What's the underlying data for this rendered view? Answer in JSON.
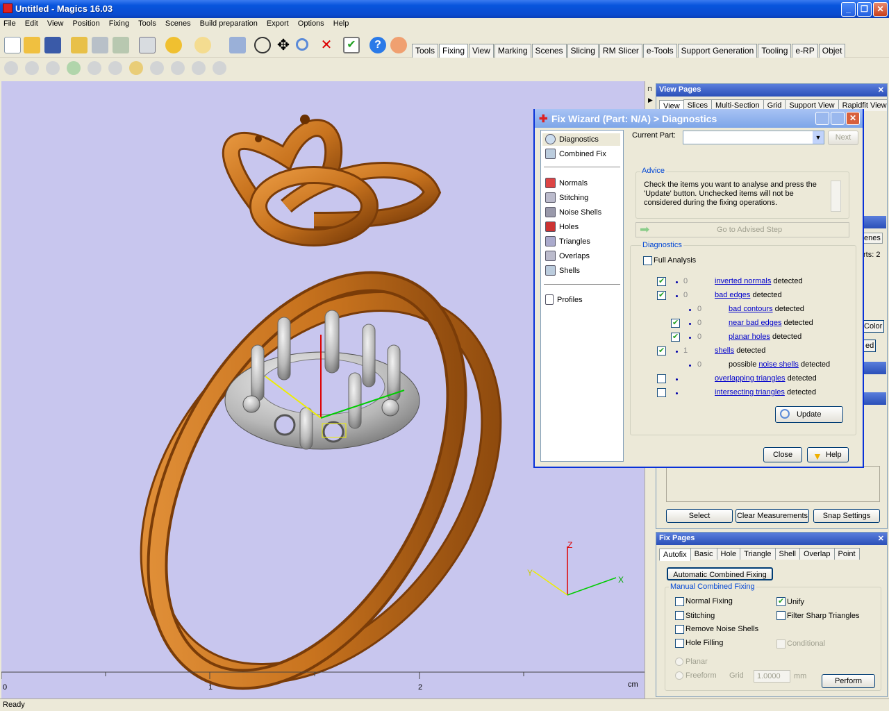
{
  "window": {
    "title": "Untitled - Magics 16.03",
    "min": "_",
    "max": "❐",
    "close": "✕"
  },
  "menu": [
    "File",
    "Edit",
    "View",
    "Position",
    "Fixing",
    "Tools",
    "Scenes",
    "Build preparation",
    "Export",
    "Options",
    "Help"
  ],
  "toolbar_tabs": [
    "Tools",
    "Fixing",
    "View",
    "Marking",
    "Scenes",
    "Slicing",
    "RM Slicer",
    "e-Tools",
    "Support Generation",
    "Tooling",
    "e-RP",
    "Objet"
  ],
  "active_toolbar_tab": "Fixing",
  "ruler": {
    "ticks": [
      "0",
      "1",
      "2"
    ],
    "unit": "cm"
  },
  "axes": {
    "x": "X",
    "y": "Y",
    "z": "Z"
  },
  "status": "Ready",
  "view_pages": {
    "title": "View Pages",
    "tabs": [
      "View",
      "Slices",
      "Multi-Section",
      "Grid",
      "Support View",
      "Rapidfit View"
    ]
  },
  "side_fragments": {
    "scenes": "enes",
    "parts": "rts: 2",
    "color": "Color",
    "ed": "ed"
  },
  "measure_buttons": {
    "select": "Select",
    "clear": "Clear Measurements",
    "snap": "Snap Settings"
  },
  "fix_pages": {
    "title": "Fix Pages",
    "tabs": [
      "Autofix",
      "Basic",
      "Hole",
      "Triangle",
      "Shell",
      "Overlap",
      "Point"
    ],
    "auto_button": "Automatic Combined Fixing",
    "group": "Manual Combined Fixing",
    "normal": "Normal Fixing",
    "unify": "Unify",
    "stitching": "Stitching",
    "filter": "Filter Sharp Triangles",
    "noise": "Remove Noise Shells",
    "hole": "Hole Filling",
    "conditional": "Conditional",
    "planar": "Planar",
    "freeform": "Freeform",
    "grid": "Grid",
    "grid_value": "1.0000",
    "mm": "mm",
    "perform": "Perform"
  },
  "fix_wizard": {
    "title": "Fix Wizard (Part: N/A) > Diagnostics",
    "nav_top": [
      "Diagnostics",
      "Combined Fix"
    ],
    "nav_mid": [
      "Normals",
      "Stitching",
      "Noise Shells",
      "Holes",
      "Triangles",
      "Overlaps",
      "Shells"
    ],
    "nav_bottom": [
      "Profiles"
    ],
    "current_part_label": "Current Part:",
    "next": "Next",
    "advice_title": "Advice",
    "advice_text": "Check the items you want to analyse and press the 'Update' button. Unchecked items will not be considered during the fixing operations.",
    "go_advised": "Go to Advised Step",
    "diagnostics_title": "Diagnostics",
    "full_analysis": "Full Analysis",
    "detected": "detected",
    "possible": "possible",
    "rows": [
      {
        "count": "0",
        "link": "inverted normals"
      },
      {
        "count": "0",
        "link": "bad edges"
      },
      {
        "count": "0",
        "link": "bad contours"
      },
      {
        "count": "0",
        "link": "near bad edges"
      },
      {
        "count": "0",
        "link": "planar holes"
      },
      {
        "count": "1",
        "link": "shells"
      },
      {
        "count": "0",
        "link": "noise shells"
      },
      {
        "count": "",
        "link": "overlapping triangles"
      },
      {
        "count": "",
        "link": "intersecting triangles"
      }
    ],
    "update": "Update",
    "close": "Close",
    "help": "Help"
  },
  "colors": {
    "accent": "#0a4bd0",
    "ring": "#c8731e",
    "viewport": "#c8c6ee",
    "link": "#0000cc"
  }
}
